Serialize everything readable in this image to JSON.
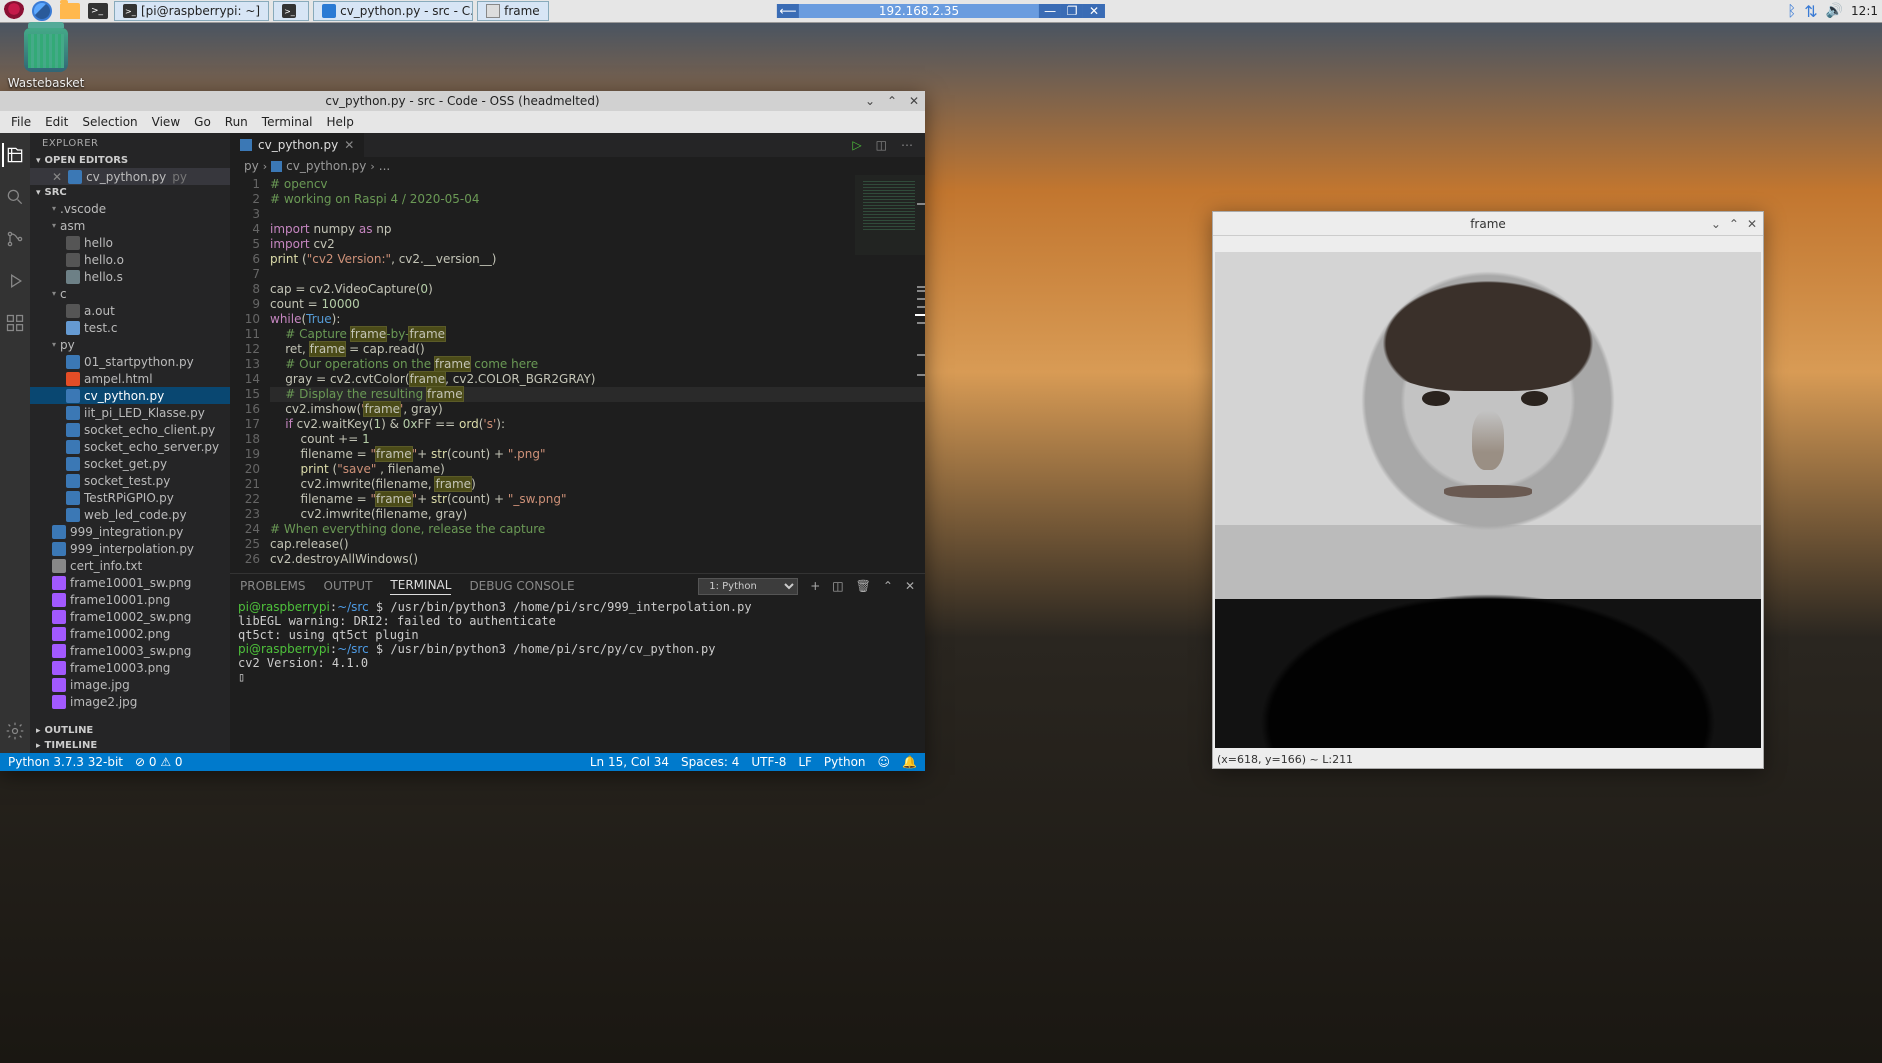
{
  "taskbar": {
    "tasks": [
      {
        "icon": "term",
        "label": "[pi@raspberrypi: ~]"
      },
      {
        "icon": "term",
        "label": ""
      },
      {
        "icon": "vsc",
        "label": "cv_python.py - src - C..."
      },
      {
        "icon": "win",
        "label": "frame"
      }
    ],
    "center_ip": "192.168.2.35",
    "clock": "12:1"
  },
  "desktop": {
    "trash": "Wastebasket"
  },
  "vscode": {
    "title": "cv_python.py - src - Code - OSS (headmelted)",
    "menu": [
      "File",
      "Edit",
      "Selection",
      "View",
      "Go",
      "Run",
      "Terminal",
      "Help"
    ],
    "explorer": {
      "title": "EXPLORER",
      "open_editors": "OPEN EDITORS",
      "editor_item": "cv_python.py",
      "editor_item_dir": "py",
      "root": "SRC",
      "tree": [
        {
          "t": "folder",
          "d": 1,
          "name": ".vscode"
        },
        {
          "t": "folder",
          "d": 1,
          "name": "asm",
          "open": true
        },
        {
          "t": "file",
          "d": 2,
          "name": "hello",
          "i": "i-bin"
        },
        {
          "t": "file",
          "d": 2,
          "name": "hello.o",
          "i": "i-bin"
        },
        {
          "t": "file",
          "d": 2,
          "name": "hello.s",
          "i": "i-s"
        },
        {
          "t": "folder",
          "d": 1,
          "name": "c",
          "open": true
        },
        {
          "t": "file",
          "d": 2,
          "name": "a.out",
          "i": "i-bin"
        },
        {
          "t": "file",
          "d": 2,
          "name": "test.c",
          "i": "i-c"
        },
        {
          "t": "folder",
          "d": 1,
          "name": "py",
          "open": true
        },
        {
          "t": "file",
          "d": 2,
          "name": "01_startpython.py",
          "i": "i-py"
        },
        {
          "t": "file",
          "d": 2,
          "name": "ampel.html",
          "i": "i-html"
        },
        {
          "t": "file",
          "d": 2,
          "name": "cv_python.py",
          "i": "i-py",
          "hl": true
        },
        {
          "t": "file",
          "d": 2,
          "name": "iit_pi_LED_Klasse.py",
          "i": "i-py"
        },
        {
          "t": "file",
          "d": 2,
          "name": "socket_echo_client.py",
          "i": "i-py"
        },
        {
          "t": "file",
          "d": 2,
          "name": "socket_echo_server.py",
          "i": "i-py"
        },
        {
          "t": "file",
          "d": 2,
          "name": "socket_get.py",
          "i": "i-py"
        },
        {
          "t": "file",
          "d": 2,
          "name": "socket_test.py",
          "i": "i-py"
        },
        {
          "t": "file",
          "d": 2,
          "name": "TestRPiGPIO.py",
          "i": "i-py"
        },
        {
          "t": "file",
          "d": 2,
          "name": "web_led_code.py",
          "i": "i-py"
        },
        {
          "t": "file",
          "d": 1,
          "name": "999_integration.py",
          "i": "i-py"
        },
        {
          "t": "file",
          "d": 1,
          "name": "999_interpolation.py",
          "i": "i-py"
        },
        {
          "t": "file",
          "d": 1,
          "name": "cert_info.txt",
          "i": "i-txt"
        },
        {
          "t": "file",
          "d": 1,
          "name": "frame10001_sw.png",
          "i": "i-img"
        },
        {
          "t": "file",
          "d": 1,
          "name": "frame10001.png",
          "i": "i-img"
        },
        {
          "t": "file",
          "d": 1,
          "name": "frame10002_sw.png",
          "i": "i-img"
        },
        {
          "t": "file",
          "d": 1,
          "name": "frame10002.png",
          "i": "i-img"
        },
        {
          "t": "file",
          "d": 1,
          "name": "frame10003_sw.png",
          "i": "i-img"
        },
        {
          "t": "file",
          "d": 1,
          "name": "frame10003.png",
          "i": "i-img"
        },
        {
          "t": "file",
          "d": 1,
          "name": "image.jpg",
          "i": "i-img"
        },
        {
          "t": "file",
          "d": 1,
          "name": "image2.jpg",
          "i": "i-img"
        }
      ],
      "outline": "OUTLINE",
      "timeline": "TIMELINE"
    },
    "tab": {
      "name": "cv_python.py"
    },
    "breadcrumb": [
      "py",
      "cv_python.py",
      "..."
    ],
    "code": {
      "lines": [
        {
          "n": 1,
          "h": "<span class='c'># opencv</span>"
        },
        {
          "n": 2,
          "h": "<span class='c'># working on Raspi 4 / 2020-05-04</span>"
        },
        {
          "n": 3,
          "h": ""
        },
        {
          "n": 4,
          "h": "<span class='k'>import</span> numpy <span class='k'>as</span> np"
        },
        {
          "n": 5,
          "h": "<span class='k'>import</span> cv2"
        },
        {
          "n": 6,
          "h": "<span class='f'>print</span> (<span class='s'>\"cv2 Version:\"</span>, cv2.__version__)"
        },
        {
          "n": 7,
          "h": ""
        },
        {
          "n": 8,
          "h": "cap = cv2.VideoCapture(<span class='n'>0</span>)"
        },
        {
          "n": 9,
          "h": "count = <span class='n'>10000</span>"
        },
        {
          "n": 10,
          "h": "<span class='k'>while</span>(<span class='b'>True</span>):"
        },
        {
          "n": 11,
          "h": "    <span class='c'># Capture </span><span class='hl-f'>frame</span><span class='c'>-by-</span><span class='hl-f'>frame</span>"
        },
        {
          "n": 12,
          "h": "    ret, <span class='hl-f'>frame</span> = cap.read()"
        },
        {
          "n": 13,
          "h": "    <span class='c'># Our operations on the </span><span class='hl-f'>frame</span><span class='c'> come here</span>"
        },
        {
          "n": 14,
          "h": "    gray = cv2.cvtColor(<span class='hl-f'>frame</span>, cv2.COLOR_BGR2GRAY)"
        },
        {
          "n": 15,
          "h": "    <span class='c'># Display the resulting </span><span class='hl-f'>frame</span>",
          "cursor": true
        },
        {
          "n": 16,
          "h": "    cv2.imshow(<span class='s'>'</span><span class='hl-f'>frame</span><span class='s'>'</span>, gray)"
        },
        {
          "n": 17,
          "h": "    <span class='k'>if</span> cv2.waitKey(<span class='n'>1</span>) &amp; <span class='n'>0x</span>FF == <span class='f'>ord</span>(<span class='s'>'s'</span>):"
        },
        {
          "n": 18,
          "h": "        count += <span class='n'>1</span>"
        },
        {
          "n": 19,
          "h": "        filename = <span class='s'>\"</span><span class='hl-f'>frame</span><span class='s'>\"</span>+ <span class='f'>str</span>(count) + <span class='s'>\".png\"</span>"
        },
        {
          "n": 20,
          "h": "        <span class='f'>print</span> (<span class='s'>\"save\"</span> , filename)"
        },
        {
          "n": 21,
          "h": "        cv2.imwrite(filename, <span class='hl-f'>frame</span>)"
        },
        {
          "n": 22,
          "h": "        filename = <span class='s'>\"</span><span class='hl-f'>frame</span><span class='s'>\"</span>+ <span class='f'>str</span>(count) + <span class='s'>\"_sw.png\"</span>"
        },
        {
          "n": 23,
          "h": "        cv2.imwrite(filename, gray)"
        },
        {
          "n": 24,
          "h": "<span class='c'># When everything done, release the capture</span>"
        },
        {
          "n": 25,
          "h": "cap.release()"
        },
        {
          "n": 26,
          "h": "cv2.destroyAllWindows()"
        }
      ]
    },
    "panel": {
      "tabs": [
        "PROBLEMS",
        "OUTPUT",
        "TERMINAL",
        "DEBUG CONSOLE"
      ],
      "active": "TERMINAL",
      "shell": "1: Python",
      "lines": [
        "<span class='g'>pi@raspberrypi</span>:<span class='bl'>~/src</span> $ /usr/bin/python3 /home/pi/src/999_interpolation.py",
        "libEGL warning: DRI2: failed to authenticate",
        "qt5ct: using qt5ct plugin",
        "<span class='g'>pi@raspberrypi</span>:<span class='bl'>~/src</span> $ /usr/bin/python3 /home/pi/src/py/cv_python.py",
        "cv2 Version: 4.1.0",
        "▯"
      ]
    },
    "status": {
      "python": "Python 3.7.3 32-bit",
      "errors": "⊘ 0  ⚠ 0",
      "ln": "Ln 15, Col 34",
      "spaces": "Spaces: 4",
      "enc": "UTF-8",
      "eol": "LF",
      "lang": "Python"
    }
  },
  "frame_win": {
    "title": "frame",
    "status": "(x=618, y=166) ~ L:211"
  }
}
